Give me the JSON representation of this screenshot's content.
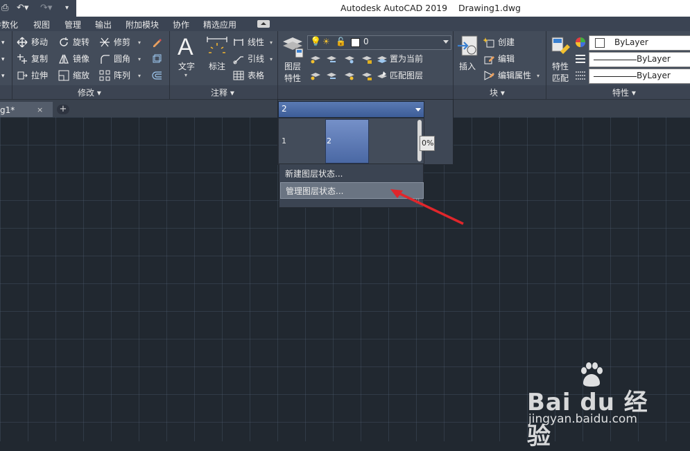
{
  "window": {
    "title": "Autodesk AutoCAD 2019    Drawing1.dwg"
  },
  "menu": [
    "参数化",
    "视图",
    "管理",
    "输出",
    "附加模块",
    "协作",
    "精选应用"
  ],
  "ribbon": {
    "modify": {
      "title": "修改",
      "tools": [
        "移动",
        "旋转",
        "修剪",
        "复制",
        "镜像",
        "圆角",
        "拉伸",
        "缩放",
        "阵列"
      ]
    },
    "annotation": {
      "title": "注释",
      "text": "文字",
      "dimension": "标注",
      "linear": "线性",
      "leader": "引线",
      "table": "表格"
    },
    "layers": {
      "layer_properties": [
        "图层",
        "特性"
      ],
      "current_layer": "0",
      "set_current": "置为当前",
      "match_layer": "匹配图层"
    },
    "block": {
      "title": "块",
      "insert": "插入",
      "create": "创建",
      "edit": "编辑",
      "edit_attributes": "编辑属性"
    },
    "properties": {
      "title": "特性",
      "match": [
        "特性",
        "匹配"
      ],
      "color": "ByLayer",
      "linetype": "ByLayer",
      "lineweight": "ByLayer"
    }
  },
  "file_tab": {
    "label": "g1*",
    "close": "×",
    "add": "+"
  },
  "layer_state_dropdown": {
    "selected": "2",
    "states": [
      "1",
      "2"
    ],
    "partial_percent": "0%",
    "menu_items": [
      "新建图层状态...",
      "管理图层状态..."
    ]
  },
  "watermark": {
    "brand": "Bai du 经验",
    "url": "jingyan.baidu.com"
  },
  "colors": {
    "accent_arrow": "#e0262b",
    "canvas": "#212830",
    "selected_state": "#5a7ab3"
  }
}
